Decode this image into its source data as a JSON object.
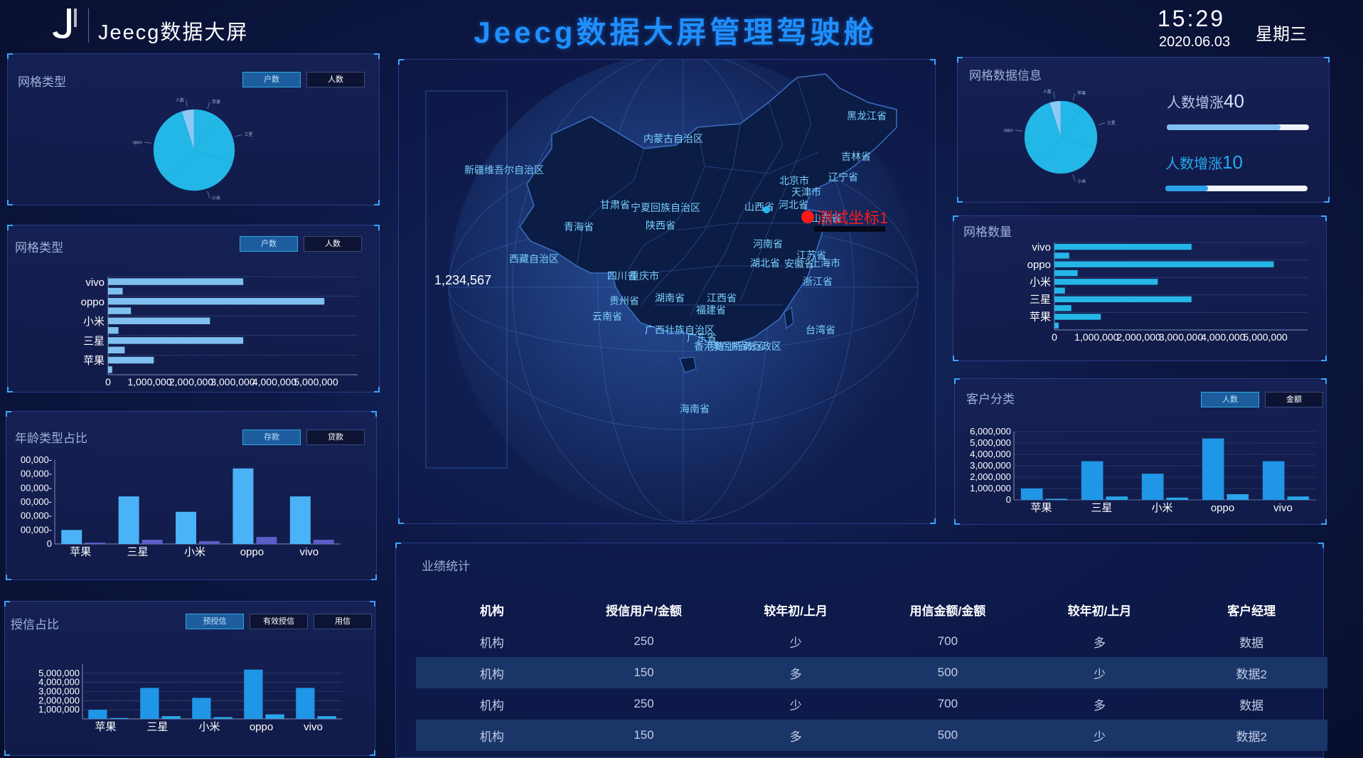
{
  "header": {
    "logo_text": "Jeecg数据大屏",
    "title": "Jeecg数据大屏管理驾驶舱",
    "time": "15:29",
    "date": "2020.06.03",
    "weekday": "星期三"
  },
  "colors": {
    "accent": "#1f8fff",
    "bar_light": "#7fc0f0",
    "bar_dark": "#1f96e6",
    "pie": "#22b7e6",
    "marker": "#ff1a1a"
  },
  "panel_grid_type_pie": {
    "title": "网格类型",
    "tabs": [
      "户数",
      "人数"
    ],
    "chart_data": {
      "type": "pie",
      "labels": [
        "苹果",
        "三星",
        "小米",
        "oppo",
        "人数"
      ],
      "values": [
        10,
        20,
        30,
        35,
        5
      ]
    }
  },
  "panel_grid_type_bar": {
    "title": "网格类型",
    "tabs": [
      "户数",
      "人数"
    ],
    "chart_data": {
      "type": "bar",
      "orientation": "horizontal",
      "categories": [
        "vivo",
        "oppo",
        "小米",
        "三星",
        "苹果"
      ],
      "series": [
        {
          "values": [
            3250000,
            5200000,
            2450000,
            3250000,
            1100000
          ]
        },
        {
          "values": [
            350000,
            550000,
            250000,
            400000,
            100000
          ]
        }
      ],
      "xticks": [
        "0",
        "1,000,000",
        "2,000,000",
        "3,000,000",
        "4,000,000",
        "5,000,000"
      ],
      "xlim": [
        0,
        6000000
      ]
    }
  },
  "panel_age": {
    "title": "年龄类型占比",
    "tabs": [
      "存款",
      "贷款"
    ],
    "chart_data": {
      "type": "bar",
      "categories": [
        "苹果",
        "三星",
        "小米",
        "oppo",
        "vivo"
      ],
      "series": [
        {
          "values": [
            1000000,
            3400000,
            2300000,
            5400000,
            3400000
          ]
        },
        {
          "values": [
            100000,
            300000,
            200000,
            500000,
            300000
          ]
        }
      ],
      "yticks": [
        "0",
        "00,000-",
        "00,000-",
        "00,000-",
        "00,000-",
        "00,000-",
        "00,000-"
      ],
      "ylim": [
        0,
        6000000
      ]
    }
  },
  "panel_credit": {
    "title": "授信占比",
    "tabs": [
      "预授信",
      "有效授信",
      "用信"
    ],
    "chart_data": {
      "type": "bar",
      "categories": [
        "苹果",
        "三星",
        "小米",
        "oppo",
        "vivo"
      ],
      "series": [
        {
          "values": [
            1000000,
            3400000,
            2300000,
            5400000,
            3400000
          ]
        },
        {
          "values": [
            100000,
            300000,
            200000,
            500000,
            300000
          ]
        }
      ],
      "yticks": [
        "1,000,000",
        "2,000,000",
        "3,000,000",
        "4,000,000",
        "5,000,000"
      ],
      "ylim": [
        0,
        6000000
      ]
    }
  },
  "map": {
    "value_label": "1,234,567",
    "marker_label": "测试坐标1",
    "provinces": [
      "黑龙江省",
      "内蒙古自治区",
      "吉林省",
      "辽宁省",
      "新疆维吾尔自治区",
      "北京市",
      "天津市",
      "河北省",
      "甘肃省",
      "宁夏回族自治区",
      "山西省",
      "青海省",
      "陕西省",
      "山东省",
      "河南省",
      "江苏省",
      "西藏自治区",
      "四川省",
      "重庆市",
      "湖北省",
      "安徽省",
      "上海市",
      "浙江省",
      "贵州省",
      "湖南省",
      "江西省",
      "福建省",
      "云南省",
      "广西壮族自治区",
      "台湾省",
      "广东省",
      "香港特别行政区",
      "澳门特别行政区",
      "海南省"
    ]
  },
  "panel_grid_info": {
    "title": "网格数据信息",
    "chart_data": {
      "type": "pie",
      "labels": [
        "苹果",
        "三星",
        "小米",
        "oppo",
        "人数"
      ],
      "values": [
        10,
        20,
        30,
        35,
        5
      ]
    },
    "stats": [
      {
        "label": "人数增涨",
        "value": "40",
        "progress": 0.8
      },
      {
        "label": "人数增涨",
        "value": "10",
        "progress": 0.3
      }
    ]
  },
  "panel_grid_count": {
    "title": "网格数量",
    "chart_data": {
      "type": "bar",
      "orientation": "horizontal",
      "categories": [
        "vivo",
        "oppo",
        "小米",
        "三星",
        "苹果"
      ],
      "series": [
        {
          "values": [
            3250000,
            5200000,
            2450000,
            3250000,
            1100000
          ]
        },
        {
          "values": [
            350000,
            550000,
            250000,
            400000,
            100000
          ]
        }
      ],
      "xticks": [
        "0",
        "1,000,000",
        "2,000,000",
        "3,000,000",
        "4,000,000",
        "5,000,000"
      ],
      "xlim": [
        0,
        6000000
      ]
    }
  },
  "panel_customer": {
    "title": "客户分类",
    "tabs": [
      "人数",
      "金额"
    ],
    "chart_data": {
      "type": "bar",
      "categories": [
        "苹果",
        "三星",
        "小米",
        "oppo",
        "vivo"
      ],
      "series": [
        {
          "values": [
            1000000,
            3400000,
            2300000,
            5400000,
            3400000
          ]
        },
        {
          "values": [
            100000,
            300000,
            200000,
            500000,
            300000
          ]
        }
      ],
      "yticks": [
        "0",
        "1,000,000",
        "2,000,000",
        "3,000,000",
        "4,000,000",
        "5,000,000",
        "6,000,000"
      ],
      "ylim": [
        0,
        6000000
      ]
    }
  },
  "performance": {
    "title": "业绩统计",
    "columns": [
      "机构",
      "授信用户/金额",
      "较年初/上月",
      "用信金额/金额",
      "较年初/上月",
      "客户经理"
    ],
    "rows": [
      [
        "机构",
        "250",
        "少",
        "700",
        "多",
        "数据"
      ],
      [
        "机构",
        "150",
        "多",
        "500",
        "少",
        "数据2"
      ],
      [
        "机构",
        "250",
        "少",
        "700",
        "多",
        "数据"
      ],
      [
        "机构",
        "150",
        "多",
        "500",
        "少",
        "数据2"
      ]
    ]
  }
}
